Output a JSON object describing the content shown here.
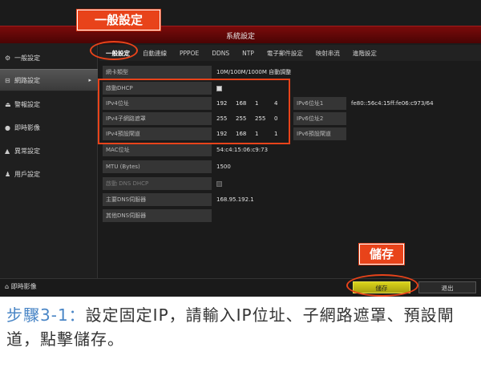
{
  "window": {
    "title": "系統設定"
  },
  "callouts": {
    "general": "一般設定",
    "save": "儲存"
  },
  "sidebar": {
    "items": [
      {
        "label": "一般設定",
        "icon": "gear-icon",
        "glyph": "⚙"
      },
      {
        "label": "網路設定",
        "icon": "network-icon",
        "glyph": "⊟",
        "active": true,
        "arrow": "▸"
      },
      {
        "label": "警報設定",
        "icon": "bell-icon",
        "glyph": "⏏"
      },
      {
        "label": "即時影像",
        "icon": "camera-icon",
        "glyph": "●"
      },
      {
        "label": "異常設定",
        "icon": "warning-icon",
        "glyph": "▲"
      },
      {
        "label": "用戶設定",
        "icon": "user-icon",
        "glyph": "♟"
      }
    ],
    "footer": {
      "label": "即時影像",
      "glyph": "⌂"
    }
  },
  "tabs": [
    "一般設定",
    "自動連線",
    "PPPOE",
    "DDNS",
    "NTP",
    "電子郵件設定",
    "映射串流",
    "進階設定"
  ],
  "fields": {
    "nic_type": {
      "label": "網卡類型",
      "value": "10M/100M/1000M 自動調整"
    },
    "dhcp": {
      "label": "啟動DHCP"
    },
    "ipv4_addr": {
      "label": "IPv4位址",
      "octets": [
        "192",
        "168",
        "1",
        "4"
      ]
    },
    "ipv4_mask": {
      "label": "IPv4子網路遮罩",
      "octets": [
        "255",
        "255",
        "255",
        "0"
      ]
    },
    "ipv4_gw": {
      "label": "IPv4預設閘道",
      "octets": [
        "192",
        "168",
        "1",
        "1"
      ]
    },
    "ipv6_addr1": {
      "label": "IPv6位址1",
      "value": "fe80::56c4:15ff:fe06:c973/64"
    },
    "ipv6_addr2": {
      "label": "IPv6位址2",
      "value": ""
    },
    "ipv6_gw": {
      "label": "IPv6預設閘道",
      "value": ""
    },
    "mac": {
      "label": "MAC位址",
      "value": "54:c4:15:06:c9:73"
    },
    "mtu": {
      "label": "MTU (Bytes)",
      "value": "1500"
    },
    "dns_dhcp": {
      "label": "啟動 DNS DHCP"
    },
    "dns1": {
      "label": "主要DNS伺服器",
      "value": "168.95.192.1"
    },
    "dns2": {
      "label": "其他DNS伺服器",
      "value": ""
    }
  },
  "buttons": {
    "save": "儲存",
    "back": "退出"
  },
  "caption": {
    "step": "步驟3-1：",
    "text": "設定固定IP，請輸入IP位址、子網路遮罩、預設閘道，點擊儲存。"
  }
}
